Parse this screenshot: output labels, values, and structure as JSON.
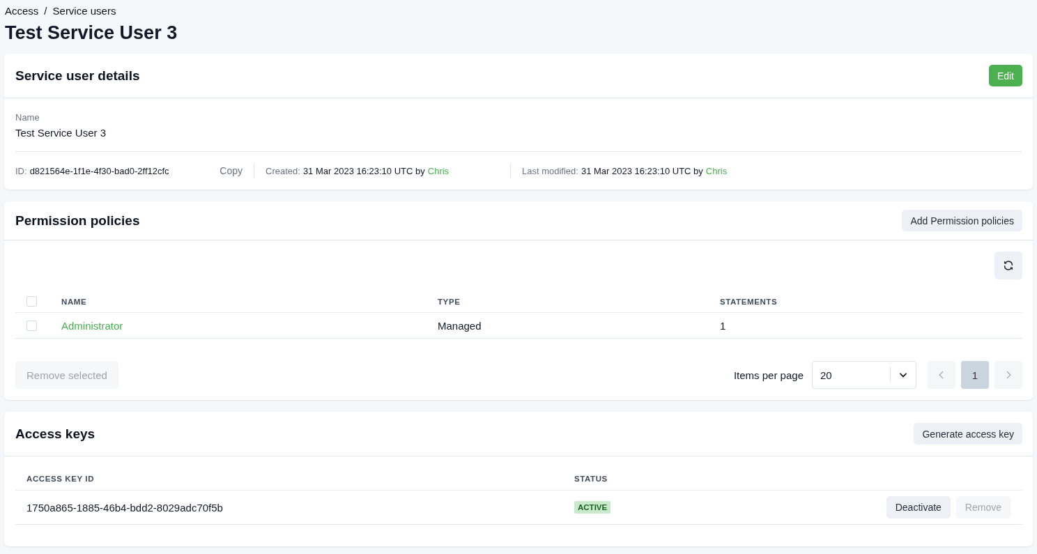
{
  "breadcrumb": {
    "items": [
      {
        "label": "Access"
      },
      {
        "label": "Service users"
      }
    ],
    "separator": "/"
  },
  "title": "Test Service User 3",
  "details": {
    "title": "Service user details",
    "edit_button": "Edit",
    "field_label": "Name",
    "field_value": "Test Service User 3",
    "meta": [
      {
        "kind": "id",
        "label": "ID:",
        "value": "d821564e-1f1e-4f30-bad0-2ff12cfc",
        "action": "Copy"
      },
      {
        "kind": "audit",
        "label": "Created:",
        "value": "31 Mar 2023 16:23:10 UTC by",
        "user": "Chris"
      },
      {
        "kind": "audit",
        "label": "Last modified:",
        "value": "31 Mar 2023 16:23:10 UTC by",
        "user": "Chris"
      }
    ]
  },
  "policies": {
    "title": "Permission policies",
    "add_button": "Add Permission policies",
    "columns": [
      "NAME",
      "TYPE",
      "STATEMENTS"
    ],
    "header_checked": false,
    "rows": [
      {
        "checked": false,
        "name": "Administrator",
        "type": "Managed",
        "statements": "1"
      }
    ],
    "remove_button": {
      "label": "Remove selected",
      "disabled": true
    },
    "items_per_page_label": "Items per page",
    "items_per_page": "20",
    "pages": [
      {
        "label": "1",
        "selected": true
      }
    ],
    "prev_disabled": true,
    "next_disabled": true
  },
  "access_keys": {
    "title": "Access keys",
    "generate_button": "Generate access key",
    "columns": [
      "ACCESS KEY ID",
      "STATUS"
    ],
    "rows": [
      {
        "id": "1750a865-1885-46b4-bdd2-8029adc70f5b",
        "status": {
          "label": "ACTIVE",
          "kind": "active"
        },
        "actions": [
          {
            "label": "Deactivate",
            "disabled": false
          },
          {
            "label": "Remove",
            "disabled": true
          }
        ]
      }
    ]
  }
}
